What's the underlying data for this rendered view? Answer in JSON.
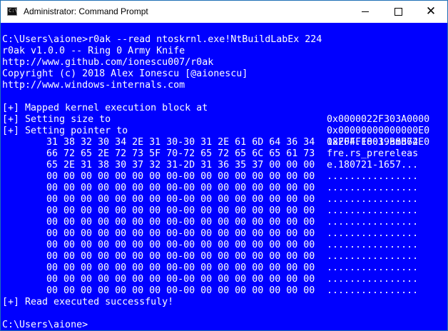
{
  "window": {
    "title": "Administrator: Command Prompt",
    "icon": "cmd-icon",
    "icon_text": "C:\\"
  },
  "console": {
    "bg_color": "#0000ff",
    "fg_color": "#ffffff",
    "header_lines": [
      "C:\\Users\\aione>r0ak --read ntoskrnl.exe!NtBuildLabEx 224",
      "r0ak v1.0.0 -- Ring 0 Army Knife",
      "http://www.github.com/ionescu007/r0ak",
      "Copyright (c) 2018 Alex Ionescu [@aionescu]",
      "http://www.windows-internals.com"
    ],
    "status_lines": [
      {
        "label": "[+] Mapped kernel execution block at",
        "value": "0x0000022F303A0000"
      },
      {
        "label": "[+] Setting size to",
        "value": "0x00000000000000E0"
      },
      {
        "label": "[+] Setting pointer to",
        "value": "0xFFFFF8039B8B72E0"
      }
    ],
    "hex_rows": [
      {
        "hex": "31 38 32 30 34 2E 31 30-30 31 2E 61 6D 64 36 34",
        "ascii": "18204.1001.amd64"
      },
      {
        "hex": "66 72 65 2E 72 73 5F 70-72 65 72 65 6C 65 61 73",
        "ascii": "fre.rs_prereleas"
      },
      {
        "hex": "65 2E 31 38 30 37 32 31-2D 31 36 35 37 00 00 00",
        "ascii": "e.180721-1657..."
      },
      {
        "hex": "00 00 00 00 00 00 00 00-00 00 00 00 00 00 00 00",
        "ascii": "................"
      },
      {
        "hex": "00 00 00 00 00 00 00 00-00 00 00 00 00 00 00 00",
        "ascii": "................"
      },
      {
        "hex": "00 00 00 00 00 00 00 00-00 00 00 00 00 00 00 00",
        "ascii": "................"
      },
      {
        "hex": "00 00 00 00 00 00 00 00-00 00 00 00 00 00 00 00",
        "ascii": "................"
      },
      {
        "hex": "00 00 00 00 00 00 00 00-00 00 00 00 00 00 00 00",
        "ascii": "................"
      },
      {
        "hex": "00 00 00 00 00 00 00 00-00 00 00 00 00 00 00 00",
        "ascii": "................"
      },
      {
        "hex": "00 00 00 00 00 00 00 00-00 00 00 00 00 00 00 00",
        "ascii": "................"
      },
      {
        "hex": "00 00 00 00 00 00 00 00-00 00 00 00 00 00 00 00",
        "ascii": "................"
      },
      {
        "hex": "00 00 00 00 00 00 00 00-00 00 00 00 00 00 00 00",
        "ascii": "................"
      },
      {
        "hex": "00 00 00 00 00 00 00 00-00 00 00 00 00 00 00 00",
        "ascii": "................"
      },
      {
        "hex": "00 00 00 00 00 00 00 00-00 00 00 00 00 00 00 00",
        "ascii": "................"
      }
    ],
    "result_line": "[+] Read executed successfuly!",
    "prompt": "C:\\Users\\aione>"
  }
}
